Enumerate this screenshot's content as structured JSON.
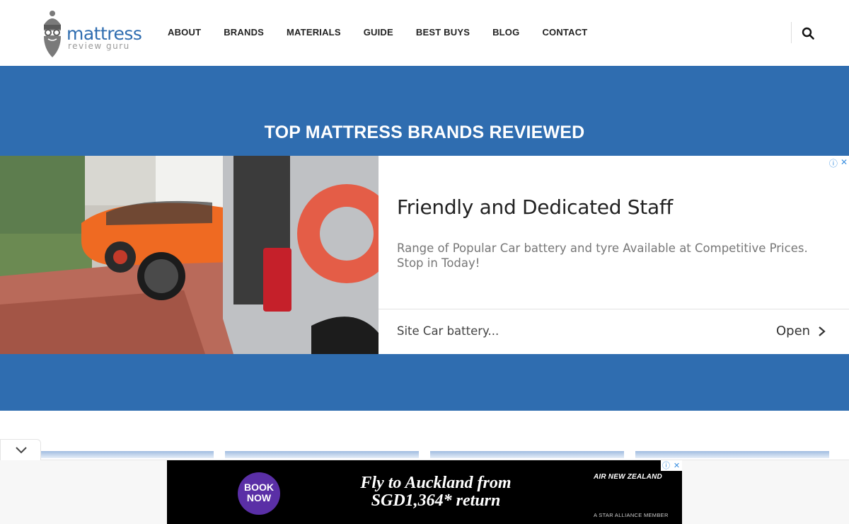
{
  "header": {
    "logo": {
      "line1": "mattress",
      "line2": "review guru"
    },
    "nav": [
      "ABOUT",
      "BRANDS",
      "MATERIALS",
      "GUIDE",
      "BEST BUYS",
      "BLOG",
      "CONTACT"
    ],
    "search_icon": "search-icon"
  },
  "hero": {
    "title": "TOP MATTRESS BRANDS REVIEWED",
    "background": "#2f6db0"
  },
  "ad": {
    "headline": "Friendly and Dedicated Staff",
    "description": "Range of Popular Car battery and tyre Available at Competitive Prices. Stop in Today!",
    "site": "Site Car battery...",
    "cta": "Open",
    "info_icon": "info-icon",
    "close_icon": "close-icon"
  },
  "bottom_banner": {
    "badge": "BOOK NOW",
    "headline_line1": "Fly to Auckland from",
    "headline_line2": "SGD1,364* return",
    "airline": "AIR NEW ZEALAND",
    "alliance": "A STAR ALLIANCE MEMBER"
  },
  "colors": {
    "brand": "#2f6db0",
    "ad_link": "#3a8fe0",
    "book_badge": "#5a2fa6"
  }
}
